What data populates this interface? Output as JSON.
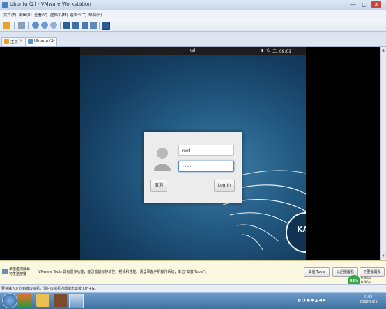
{
  "window": {
    "title": "Ubuntu (2) - VMware Workstation",
    "minimize": "—",
    "maximize": "▢",
    "close": "✕"
  },
  "menu": [
    "文件(F)",
    "编辑(E)",
    "查看(V)",
    "虚拟机(M)",
    "选项卡(T)",
    "帮助(H)"
  ],
  "tabs": {
    "home": "主页",
    "vm": "Ubuntu (2)",
    "close_glyph": "×"
  },
  "guest": {
    "hostname": "kali",
    "clock": "二, 08:03",
    "login": {
      "username": "root",
      "password_mask": "••••",
      "cancel_label": "取消",
      "login_label": "Log In"
    }
  },
  "notice": {
    "left_line1": "单击虚拟屏幕",
    "left_line2": "可发送按键",
    "message": "VMware Tools 具有很多功能，能改善鼠标移动性、视频和性能。请登录客户机操作系统，单击\"安装 Tools\"。",
    "install_tools": "安装 Tools",
    "remind_later": "以后提醒我",
    "never_remind": "不要提醒我"
  },
  "statusbar": {
    "text": "要将输入定向到该虚拟机，请在虚拟机内部单击或按 Ctrl+G。"
  },
  "tray": {
    "net_percent": "43%",
    "up_speed": "0.4K/s",
    "down_speed": "0.4K/s",
    "time": "8:03",
    "date": "2018/8/21"
  },
  "colors": {
    "accent": "#4f8cc9",
    "taskbar": "#3d6f9f",
    "notice_bg": "#fbf8e1"
  }
}
